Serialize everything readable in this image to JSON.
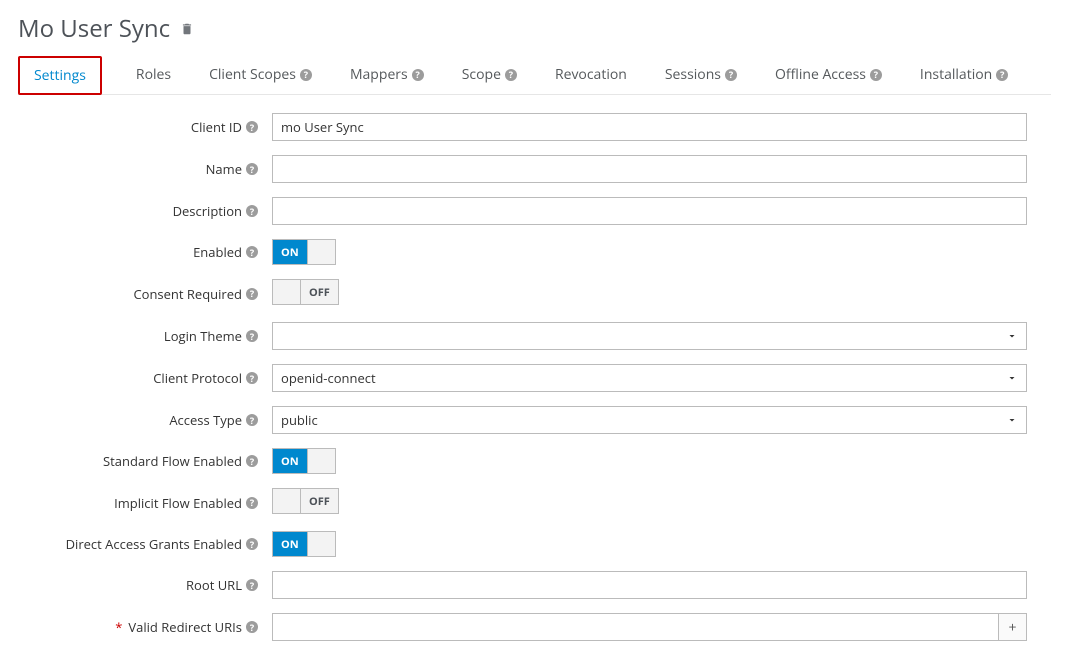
{
  "header": {
    "title": "Mo User Sync"
  },
  "tabs": [
    {
      "label": "Settings",
      "help": false,
      "active": true
    },
    {
      "label": "Roles",
      "help": false
    },
    {
      "label": "Client Scopes",
      "help": true
    },
    {
      "label": "Mappers",
      "help": true
    },
    {
      "label": "Scope",
      "help": true
    },
    {
      "label": "Revocation",
      "help": false
    },
    {
      "label": "Sessions",
      "help": true
    },
    {
      "label": "Offline Access",
      "help": true
    },
    {
      "label": "Installation",
      "help": true
    }
  ],
  "form": {
    "client_id": {
      "label": "Client ID",
      "value": "mo User Sync"
    },
    "name": {
      "label": "Name",
      "value": ""
    },
    "description": {
      "label": "Description",
      "value": ""
    },
    "enabled": {
      "label": "Enabled",
      "value": true
    },
    "consent_required": {
      "label": "Consent Required",
      "value": false
    },
    "login_theme": {
      "label": "Login Theme",
      "value": ""
    },
    "client_protocol": {
      "label": "Client Protocol",
      "value": "openid-connect"
    },
    "access_type": {
      "label": "Access Type",
      "value": "public"
    },
    "standard_flow": {
      "label": "Standard Flow Enabled",
      "value": true
    },
    "implicit_flow": {
      "label": "Implicit Flow Enabled",
      "value": false
    },
    "direct_access": {
      "label": "Direct Access Grants Enabled",
      "value": true
    },
    "root_url": {
      "label": "Root URL",
      "value": ""
    },
    "valid_redirect": {
      "label": "Valid Redirect URIs",
      "value": ""
    }
  },
  "toggle_labels": {
    "on": "ON",
    "off": "OFF"
  }
}
